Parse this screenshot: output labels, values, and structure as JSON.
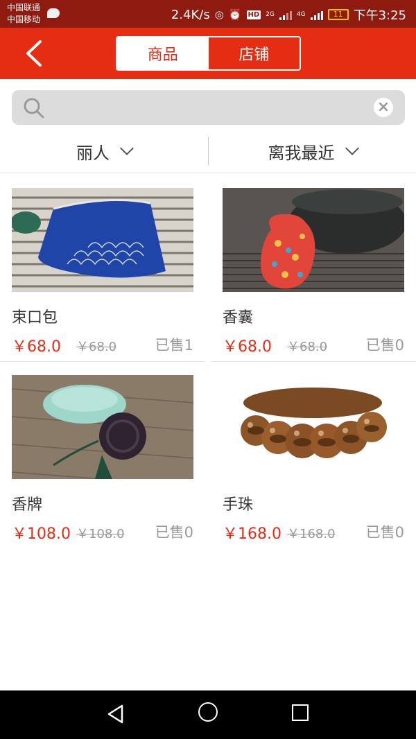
{
  "status_bar": {
    "carrier1": "中国联通",
    "carrier2": "中国移动",
    "speed": "2.4K/s",
    "hd": "HD",
    "net1": "2G",
    "net2": "4G",
    "battery": "11",
    "time": "下午3:25"
  },
  "app_bar": {
    "tabs": [
      {
        "label": "商品",
        "active": true
      },
      {
        "label": "店铺",
        "active": false
      }
    ]
  },
  "search": {
    "placeholder": "",
    "value": ""
  },
  "filters": {
    "category": "丽人",
    "sort": "离我最近"
  },
  "products": [
    {
      "title": "束口包",
      "price": "￥68.0",
      "old_price": "￥68.0",
      "sold": "已售1"
    },
    {
      "title": "香囊",
      "price": "￥68.0",
      "old_price": "￥68.0",
      "sold": "已售0"
    },
    {
      "title": "香牌",
      "price": "￥108.0",
      "old_price": "￥108.0",
      "sold": "已售0"
    },
    {
      "title": "手珠",
      "price": "￥168.0",
      "old_price": "￥168.0",
      "sold": "已售0"
    }
  ],
  "colors": {
    "brand": "#e52d13",
    "status_bar": "#8e1a10"
  }
}
